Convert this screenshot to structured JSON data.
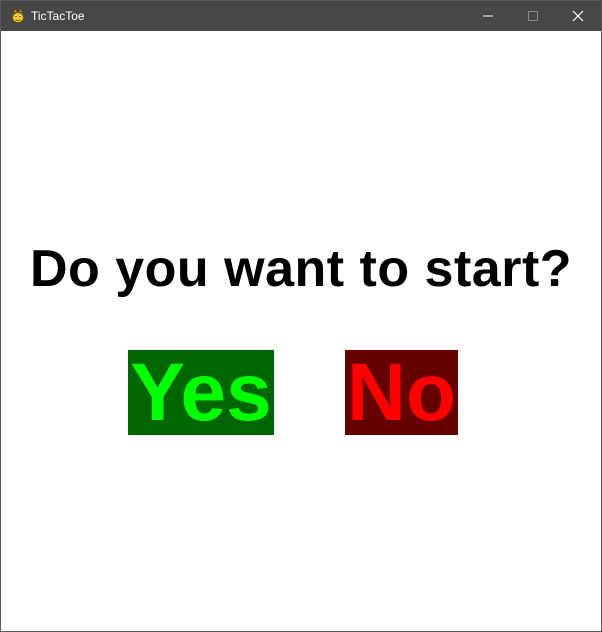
{
  "window": {
    "title": "TicTacToe",
    "icon": "pygame-snake-icon",
    "controls": {
      "minimize": "minimize-icon",
      "maximize": "maximize-icon",
      "close": "close-icon"
    }
  },
  "main": {
    "prompt": "Do you want to start?",
    "yes_label": "Yes",
    "no_label": "No"
  },
  "colors": {
    "titlebar": "#474747",
    "background": "#ffffff",
    "yes_bg": "#006400",
    "yes_text": "#00ff00",
    "no_bg": "#640000",
    "no_text": "#ff0000"
  }
}
